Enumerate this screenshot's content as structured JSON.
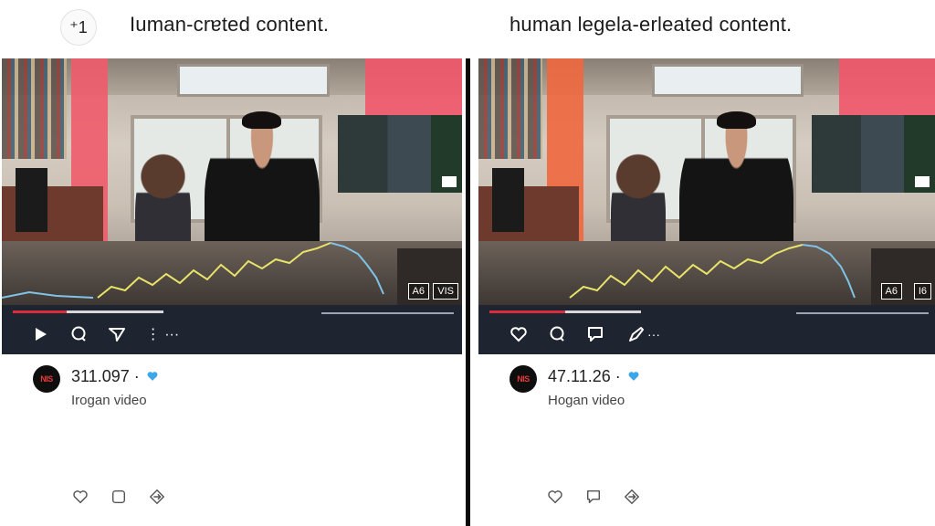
{
  "left": {
    "badge": "⁺1",
    "title": "Iuman-crɐted content.",
    "video": {
      "tags": [
        "A6",
        "VIS"
      ],
      "progress": 0.36
    },
    "controls": [
      "play-icon",
      "comment-icon",
      "send-icon",
      "more-icon"
    ],
    "more_label": "⋮ ···",
    "count": "311.097 ·",
    "channel": "Irogan video",
    "actions": [
      "heart-icon",
      "comment-icon",
      "share-icon"
    ]
  },
  "right": {
    "title": "human legela-erleated content.",
    "video": {
      "tags": [
        "A6",
        "I6"
      ],
      "progress": 0.5
    },
    "controls": [
      "heart-icon",
      "comment-icon",
      "chat-icon",
      "edit-icon"
    ],
    "more_label": "···",
    "count": "47.11.26 ·",
    "channel": "Hogan video",
    "actions": [
      "heart-icon",
      "comment-icon",
      "share-icon"
    ]
  },
  "avatar_text": "NIS",
  "colors": {
    "accent_red": "#d92d3c",
    "control_bar": "#1f2530",
    "verified_blue": "#3ba6e8",
    "wave_yellow": "#e9e36a",
    "wave_blue": "#7fc3e8"
  }
}
